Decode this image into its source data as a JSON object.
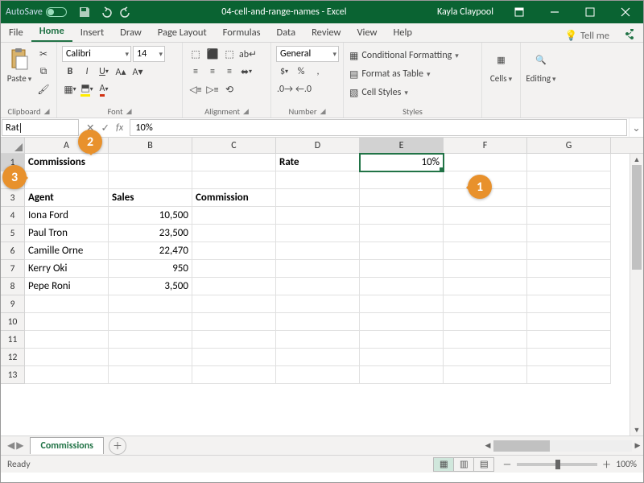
{
  "title": {
    "autosave": "AutoSave",
    "doc": "04-cell-and-range-names - Excel",
    "user": "Kayla Claypool"
  },
  "tabs": {
    "file": "File",
    "home": "Home",
    "insert": "Insert",
    "draw": "Draw",
    "layout": "Page Layout",
    "formulas": "Formulas",
    "data": "Data",
    "review": "Review",
    "view": "View",
    "help": "Help",
    "tellme": "Tell me"
  },
  "ribbon": {
    "clipboard": "Clipboard",
    "paste": "Paste",
    "font": "Font",
    "font_name": "Calibri",
    "font_size": "14",
    "alignment": "Alignment",
    "number": "Number",
    "number_format": "General",
    "styles": "Styles",
    "condfmt": "Conditional Formatting",
    "fmttable": "Format as Table",
    "cellstyles": "Cell Styles",
    "cells": "Cells",
    "editing": "Editing"
  },
  "fbar": {
    "namebox": "Rat",
    "fx": "fx",
    "formula": "10%"
  },
  "cols": [
    "A",
    "B",
    "C",
    "D",
    "E",
    "F",
    "G"
  ],
  "rowcount": 13,
  "cells": {
    "A1": "Commissions",
    "D1": "Rate",
    "E1": "10%",
    "A3": "Agent",
    "B3": "Sales",
    "C3": "Commission",
    "A4": "Iona Ford",
    "B4": "10,500",
    "A5": "Paul Tron",
    "B5": "23,500",
    "A6": "Camille Orne",
    "B6": "22,470",
    "A7": "Kerry Oki",
    "B7": "950",
    "A8": "Pepe Roni",
    "B8": "3,500"
  },
  "sheet": {
    "name": "Commissions"
  },
  "status": {
    "ready": "Ready",
    "zoom": "100%"
  },
  "callouts": {
    "c1": "1",
    "c2": "2",
    "c3": "3"
  }
}
